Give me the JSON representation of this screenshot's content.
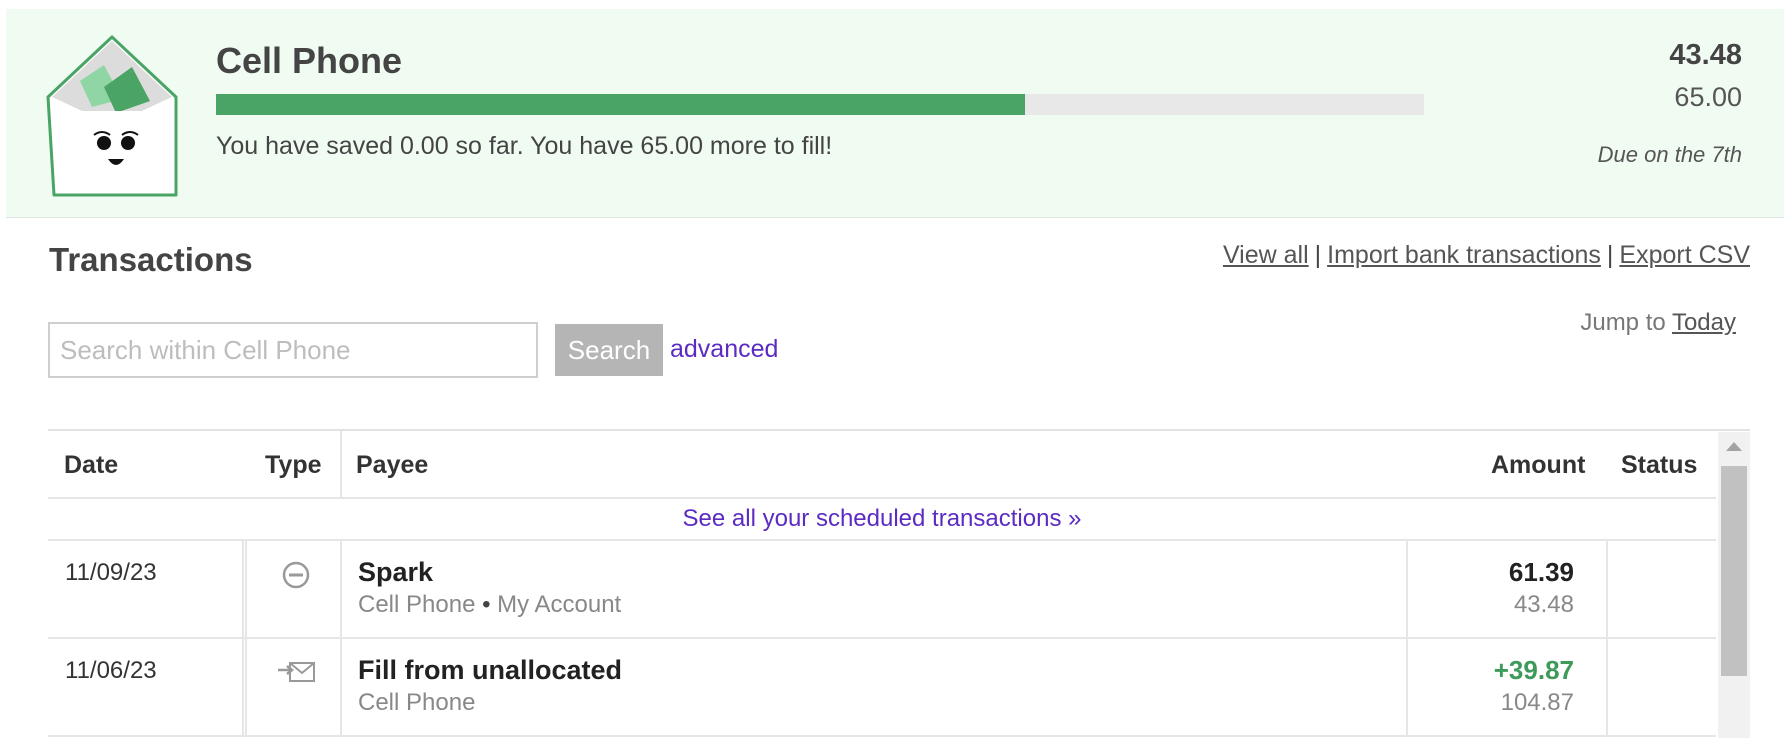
{
  "envelope": {
    "name": "Cell Phone",
    "balance": "43.48",
    "budget": "65.00",
    "progress_fraction": 0.67,
    "message": "You have saved 0.00 so far. You have 65.00 more to fill!",
    "due": "Due on the 7th",
    "icon": "smiling-envelope-icon"
  },
  "transactions": {
    "title": "Transactions",
    "links": {
      "view_all": "View all",
      "import": "Import bank transactions",
      "export": "Export CSV",
      "separator": "|"
    },
    "search": {
      "placeholder": "Search within Cell Phone",
      "value": "",
      "button": "Search",
      "advanced": "advanced"
    },
    "jump": {
      "label": "Jump to",
      "link": "Today"
    },
    "columns": [
      "Date",
      "Type",
      "Payee",
      "Amount",
      "Status"
    ],
    "scheduled_link": "See all your scheduled transactions »",
    "rows": [
      {
        "date": "11/09/23",
        "type_icon": "minus-circle-icon",
        "payee": "Spark",
        "envelope": "Cell Phone",
        "bullet": "•",
        "account": "My Account",
        "amount": "61.39",
        "running": "43.48",
        "amount_color": "#222222"
      },
      {
        "date": "11/06/23",
        "type_icon": "envelope-fill-icon",
        "payee": "Fill from unallocated",
        "envelope": "Cell Phone",
        "bullet": "",
        "account": "",
        "amount": "+39.87",
        "running": "104.87",
        "amount_color": "#3e9a5a"
      }
    ]
  },
  "colors": {
    "header_bg": "#f0fbf2",
    "progress": "#4aa466",
    "link_purple": "#5b2bc2",
    "positive": "#3e9a5a"
  }
}
